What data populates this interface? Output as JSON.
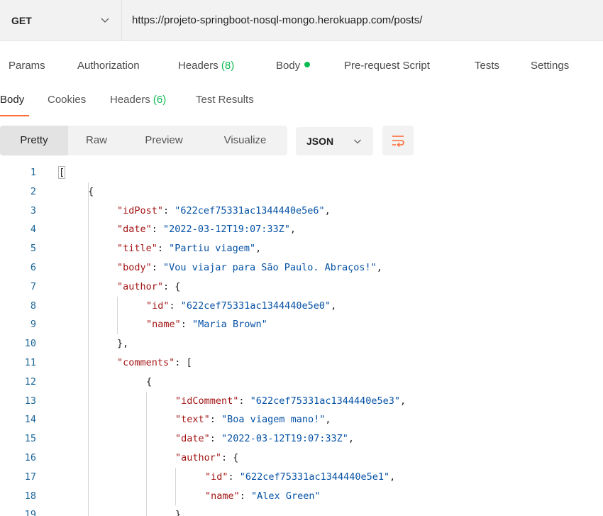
{
  "request": {
    "method": "GET",
    "url": "https://projeto-springboot-nosql-mongo.herokuapp.com/posts/"
  },
  "request_tabs": {
    "params": "Params",
    "authorization": "Authorization",
    "headers": "Headers",
    "headers_count": "(8)",
    "body": "Body",
    "pre_request": "Pre-request Script",
    "tests": "Tests",
    "settings": "Settings"
  },
  "response_tabs": {
    "body": "Body",
    "cookies": "Cookies",
    "headers": "Headers",
    "headers_count": "(6)",
    "test_results": "Test Results"
  },
  "view_modes": {
    "pretty": "Pretty",
    "raw": "Raw",
    "preview": "Preview",
    "visualize": "Visualize"
  },
  "format": {
    "selected": "JSON"
  },
  "icons": {
    "method_chevron": "chevron-down-icon",
    "format_chevron": "chevron-down-icon",
    "wrap": "wrap-lines-icon",
    "body_dot": "status-dot-icon"
  },
  "colors": {
    "accent_orange": "#ff6c37",
    "count_green": "#0cbb52",
    "json_key": "#a31515",
    "json_string": "#0451a5",
    "line_number": "#1a6496"
  },
  "code": {
    "lines": [
      {
        "n": "1",
        "pre": "",
        "key": "",
        "mid": "[",
        "str": "",
        "post": ""
      },
      {
        "n": "2",
        "pre": "",
        "key": "",
        "mid": "{",
        "str": "",
        "post": ""
      },
      {
        "n": "3",
        "pre": "",
        "key": "\"idPost\"",
        "mid": ": ",
        "str": "\"622cef75331ac1344440e5e6\"",
        "post": ","
      },
      {
        "n": "4",
        "pre": "",
        "key": "\"date\"",
        "mid": ": ",
        "str": "\"2022-03-12T19:07:33Z\"",
        "post": ","
      },
      {
        "n": "5",
        "pre": "",
        "key": "\"title\"",
        "mid": ": ",
        "str": "\"Partiu viagem\"",
        "post": ","
      },
      {
        "n": "6",
        "pre": "",
        "key": "\"body\"",
        "mid": ": ",
        "str": "\"Vou viajar para São Paulo. Abraços!\"",
        "post": ","
      },
      {
        "n": "7",
        "pre": "",
        "key": "\"author\"",
        "mid": ": {",
        "str": "",
        "post": ""
      },
      {
        "n": "8",
        "pre": "",
        "key": "\"id\"",
        "mid": ": ",
        "str": "\"622cef75331ac1344440e5e0\"",
        "post": ","
      },
      {
        "n": "9",
        "pre": "",
        "key": "\"name\"",
        "mid": ": ",
        "str": "\"Maria Brown\"",
        "post": ""
      },
      {
        "n": "10",
        "pre": "",
        "key": "",
        "mid": "},",
        "str": "",
        "post": ""
      },
      {
        "n": "11",
        "pre": "",
        "key": "\"comments\"",
        "mid": ": [",
        "str": "",
        "post": ""
      },
      {
        "n": "12",
        "pre": "",
        "key": "",
        "mid": "{",
        "str": "",
        "post": ""
      },
      {
        "n": "13",
        "pre": "",
        "key": "\"idComment\"",
        "mid": ": ",
        "str": "\"622cef75331ac1344440e5e3\"",
        "post": ","
      },
      {
        "n": "14",
        "pre": "",
        "key": "\"text\"",
        "mid": ": ",
        "str": "\"Boa viagem mano!\"",
        "post": ","
      },
      {
        "n": "15",
        "pre": "",
        "key": "\"date\"",
        "mid": ": ",
        "str": "\"2022-03-12T19:07:33Z\"",
        "post": ","
      },
      {
        "n": "16",
        "pre": "",
        "key": "\"author\"",
        "mid": ": {",
        "str": "",
        "post": ""
      },
      {
        "n": "17",
        "pre": "",
        "key": "\"id\"",
        "mid": ": ",
        "str": "\"622cef75331ac1344440e5e1\"",
        "post": ","
      },
      {
        "n": "18",
        "pre": "",
        "key": "\"name\"",
        "mid": ": ",
        "str": "\"Alex Green\"",
        "post": ""
      },
      {
        "n": "19",
        "pre": "",
        "key": "",
        "mid": "}",
        "str": "",
        "post": ""
      }
    ]
  }
}
